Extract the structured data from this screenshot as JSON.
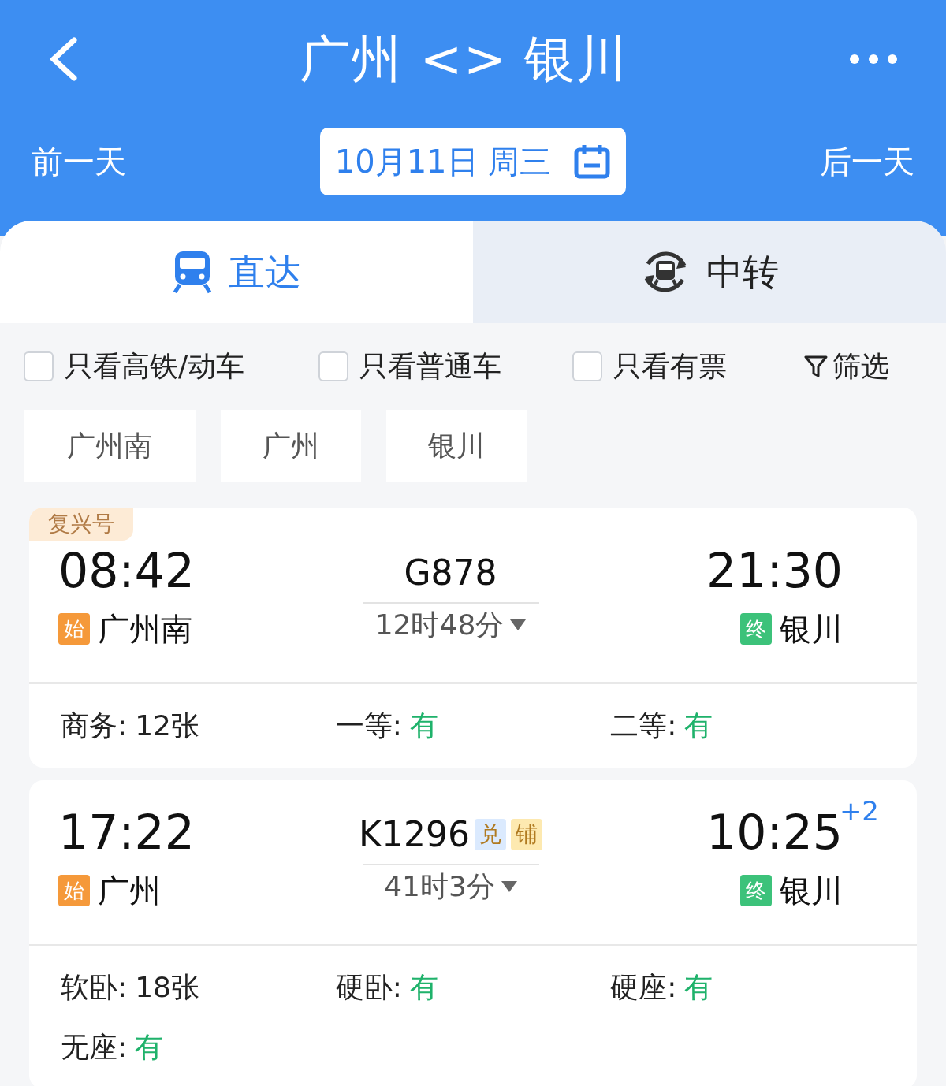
{
  "header": {
    "title": "广州 <> 银川",
    "prev_day": "前一天",
    "date": "10月11日 周三",
    "next_day": "后一天"
  },
  "tabs": [
    {
      "label": "直达",
      "selected": true,
      "kind": "direct"
    },
    {
      "label": "中转",
      "selected": false,
      "kind": "transfer"
    }
  ],
  "filters": [
    {
      "label": "只看高铁/动车",
      "checked": false
    },
    {
      "label": "只看普通车",
      "checked": false
    },
    {
      "label": "只看有票",
      "checked": false
    }
  ],
  "filter_button": "筛选",
  "stations": [
    {
      "label": "广州南",
      "selected": false
    },
    {
      "label": "广州",
      "selected": false
    },
    {
      "label": "银川",
      "selected": false
    }
  ],
  "trains": [
    {
      "tag": "复兴号",
      "depart_time": "08:42",
      "depart_mark": "始",
      "depart_station": "广州南",
      "number": "G878",
      "duration": "12时48分",
      "arrive_time": "21:30",
      "arrive_mark": "终",
      "arrive_station": "银川",
      "seats": [
        {
          "label": "商务:",
          "value": "12张",
          "kind": "count"
        },
        {
          "label": "一等:",
          "value": "有",
          "kind": "available"
        },
        {
          "label": "二等:",
          "value": "有",
          "kind": "available"
        }
      ]
    },
    {
      "depart_time": "17:22",
      "depart_mark": "始",
      "depart_station": "广州",
      "number": "K1296",
      "badges": [
        {
          "label": "兑",
          "color": "#dbeafe"
        },
        {
          "label": "铺",
          "color": "#fde9b0"
        }
      ],
      "duration": "41时3分",
      "arrive_time": "10:25",
      "day_offset": "+2",
      "arrive_mark": "终",
      "arrive_station": "银川",
      "seats": [
        {
          "label": "软卧:",
          "value": "18张",
          "kind": "count"
        },
        {
          "label": "硬卧:",
          "value": "有",
          "kind": "available"
        },
        {
          "label": "硬座:",
          "value": "有",
          "kind": "available"
        },
        {
          "label": "无座:",
          "value": "有",
          "kind": "available"
        }
      ]
    }
  ]
}
